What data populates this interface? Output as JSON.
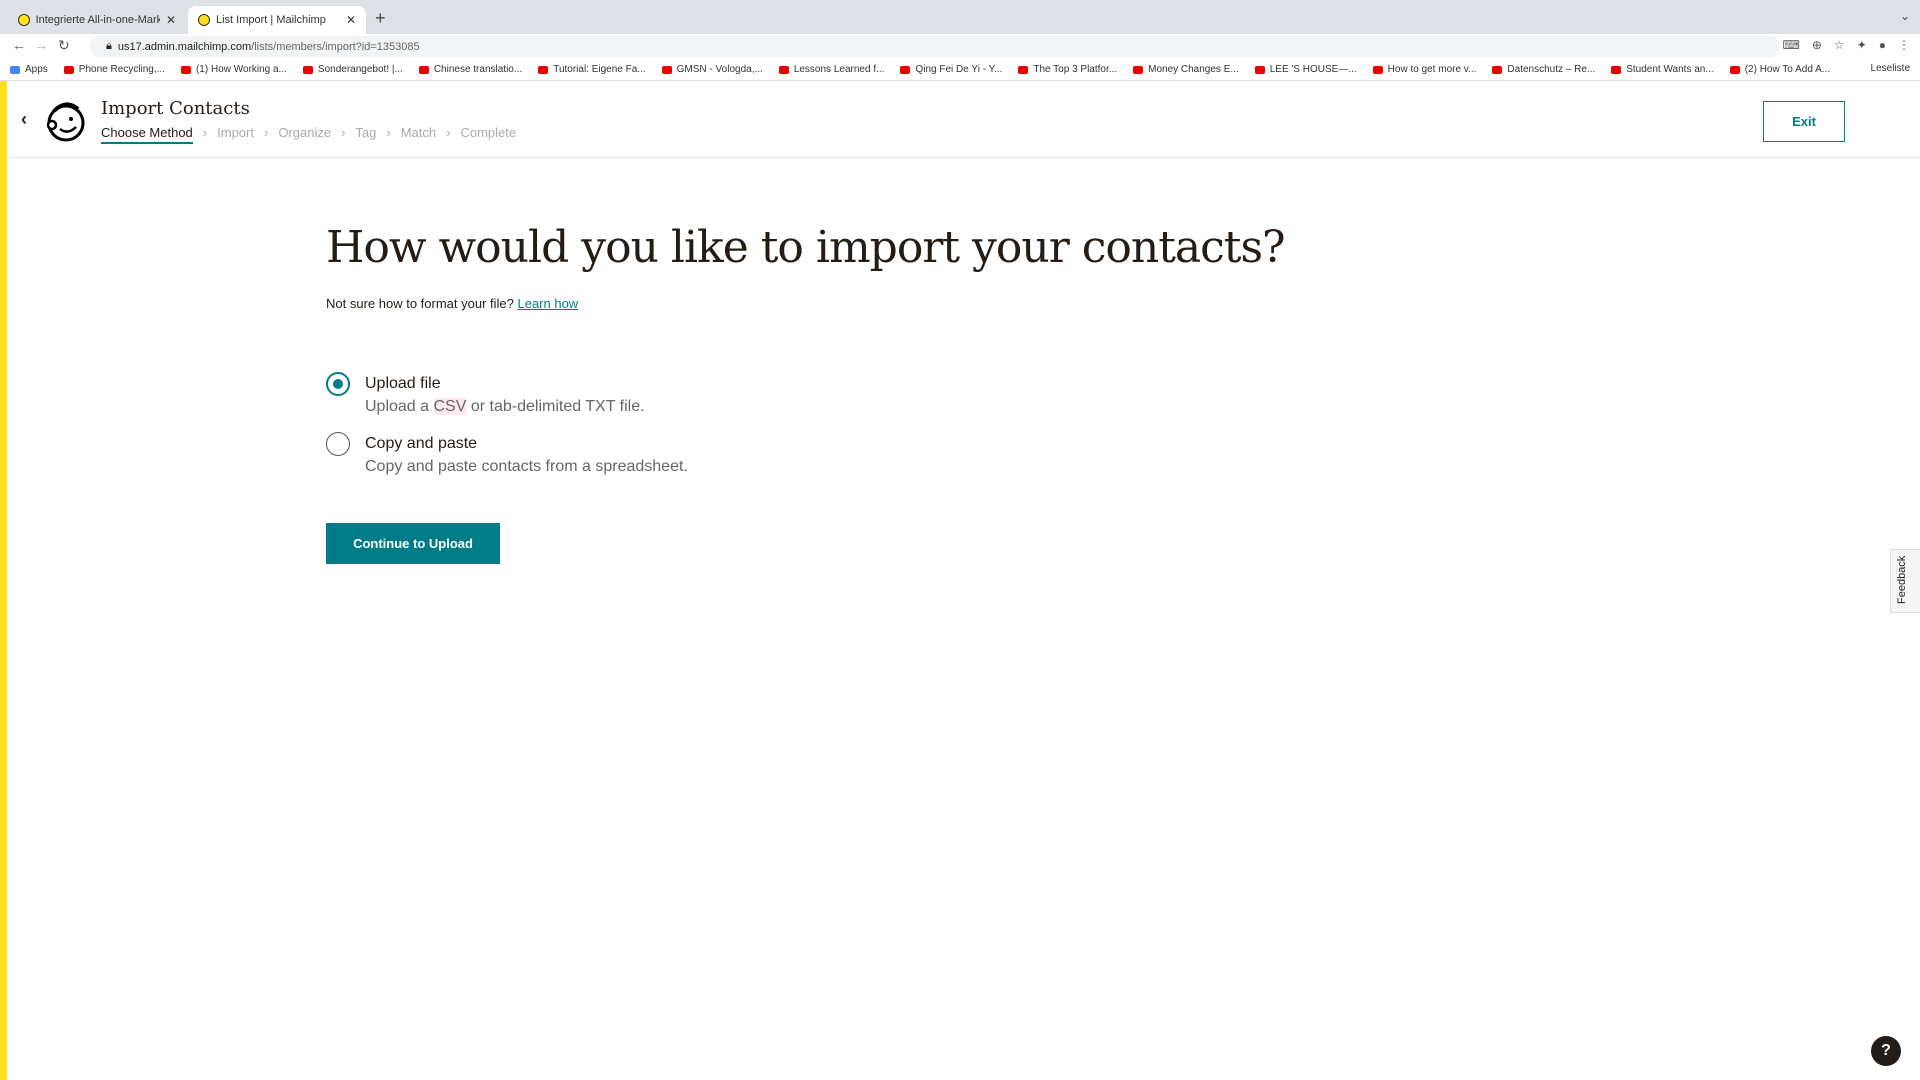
{
  "browser": {
    "tabs": [
      {
        "label": "Integrierte All-in-one-Marketin"
      },
      {
        "label": "List Import | Mailchimp"
      }
    ],
    "url_host": "us17.admin.mailchimp.com",
    "url_path": "/lists/members/import?id=1353085",
    "bookmarks": [
      "Apps",
      "Phone Recycling,...",
      "(1) How Working a...",
      "Sonderangebot! |...",
      "Chinese translatio...",
      "Tutorial: Eigene Fa...",
      "GMSN - Vologda,...",
      "Lessons Learned f...",
      "Qing Fei De Yi - Y...",
      "The Top 3 Platfor...",
      "Money Changes E...",
      "LEE 'S HOUSE—...",
      "How to get more v...",
      "Datenschutz – Re...",
      "Student Wants an...",
      "(2) How To Add A..."
    ],
    "reading_list": "Leseliste"
  },
  "header": {
    "title": "Import Contacts",
    "steps": [
      "Choose Method",
      "Import",
      "Organize",
      "Tag",
      "Match",
      "Complete"
    ],
    "exit": "Exit"
  },
  "main": {
    "heading": "How would you like to import your contacts?",
    "help_text": "Not sure how to format your file?",
    "help_link": "Learn how",
    "options": [
      {
        "label": "Upload file",
        "desc_pre": "Upload a ",
        "desc_hl": "CSV",
        "desc_post": " or tab-delimited TXT file.",
        "selected": true
      },
      {
        "label": "Copy and paste",
        "desc": "Copy and paste contacts from a spreadsheet.",
        "selected": false
      }
    ],
    "continue": "Continue to Upload"
  },
  "feedback": "Feedback",
  "help": "?",
  "colors": {
    "accent": "#007c89",
    "brand_yellow": "#ffe01b"
  }
}
